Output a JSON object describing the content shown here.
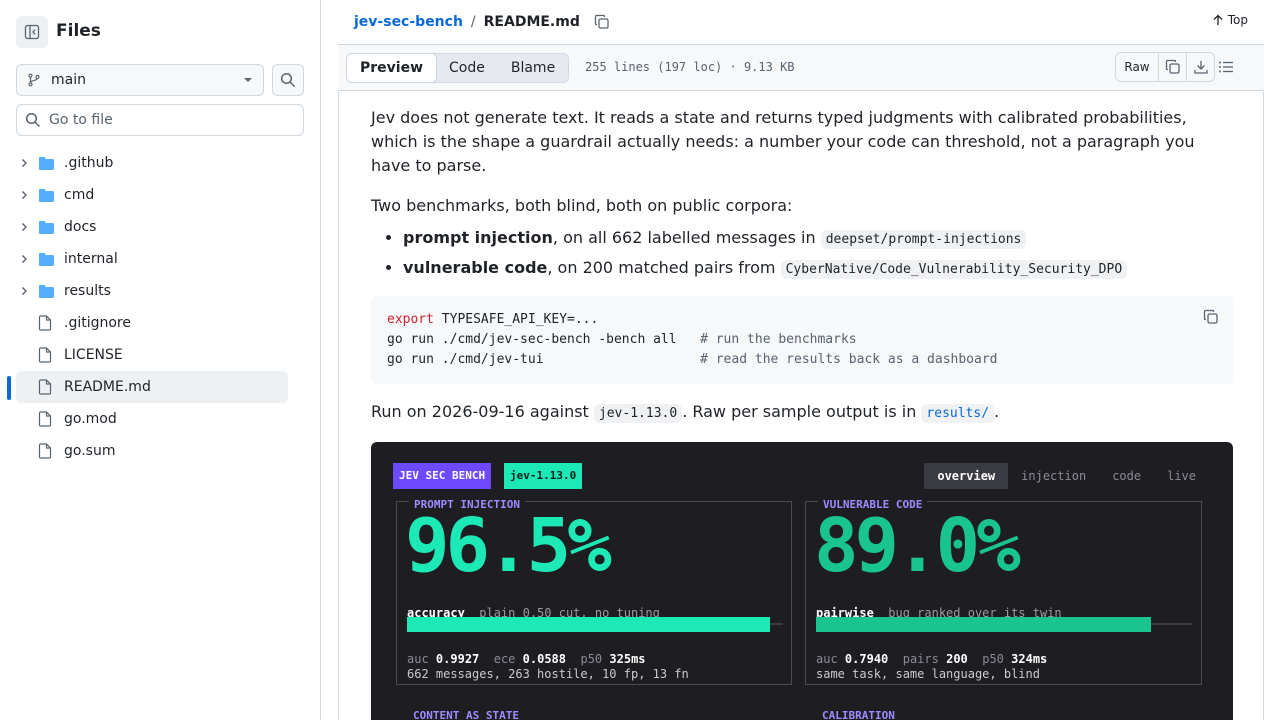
{
  "sidebar": {
    "title": "Files",
    "branch": "main",
    "goto_placeholder": "Go to file",
    "items": [
      {
        "name": ".github",
        "type": "folder"
      },
      {
        "name": "cmd",
        "type": "folder"
      },
      {
        "name": "docs",
        "type": "folder"
      },
      {
        "name": "internal",
        "type": "folder"
      },
      {
        "name": "results",
        "type": "folder"
      },
      {
        "name": ".gitignore",
        "type": "file"
      },
      {
        "name": "LICENSE",
        "type": "file"
      },
      {
        "name": "README.md",
        "type": "file",
        "active": true
      },
      {
        "name": "go.mod",
        "type": "file"
      },
      {
        "name": "go.sum",
        "type": "file"
      }
    ]
  },
  "header": {
    "repo": "jev-sec-bench",
    "separator": "/",
    "file": "README.md",
    "top_label": "Top"
  },
  "toolbar": {
    "tabs": [
      "Preview",
      "Code",
      "Blame"
    ],
    "selected_tab": "Preview",
    "file_info": "255 lines (197 loc) · 9.13 KB",
    "raw_label": "Raw"
  },
  "readme": {
    "para1": "Jev does not generate text. It reads a state and returns typed judgments with calibrated probabilities, which is the shape a guardrail actually needs: a number your code can threshold, not a paragraph you have to parse.",
    "para2": "Two benchmarks, both blind, both on public corpora:",
    "bullets": [
      {
        "bold": "prompt injection",
        "text": ", on all 662 labelled messages in ",
        "code": "deepset/prompt-injections"
      },
      {
        "bold": "vulnerable code",
        "text": ", on 200 matched pairs from ",
        "code": "CyberNative/Code_Vulnerability_Security_DPO"
      }
    ],
    "code_lines": {
      "l1_kw": "export",
      "l1_rest": " TYPESAFE_API_KEY=...",
      "l2_cmd": "go run ./cmd/jev-sec-bench -bench all   ",
      "l2_comment": "# run the benchmarks",
      "l3_cmd": "go run ./cmd/jev-tui                    ",
      "l3_comment": "# read the results back as a dashboard"
    },
    "run_line": {
      "t1": "Run on 2026-09-16 against ",
      "code": "jev-1.13.0",
      "t2": ". Raw per sample output is in ",
      "link": "results/",
      "t3": "."
    }
  },
  "dashboard": {
    "badge": "JEV SEC BENCH",
    "version": "jev-1.13.0",
    "tabs": [
      "overview",
      "injection",
      "code",
      "live"
    ],
    "active_tab": "overview",
    "panels": [
      {
        "title": "PROMPT INJECTION",
        "big": "96.5%",
        "big_color": "#1de9b6",
        "metric": "accuracy",
        "metric_note": "plain 0.50 cut, no tuning",
        "bar_fraction": 0.965,
        "bar_color": "#1de9b6",
        "k1": "auc",
        "v1": "0.9927",
        "k2": "ece",
        "v2": "0.0588",
        "k3": "p50",
        "v3": "325ms",
        "footer": "662 messages, 263 hostile, 10 fp, 13 fn"
      },
      {
        "title": "VULNERABLE CODE",
        "big": "89.0%",
        "big_color": "#19c48f",
        "metric": "pairwise",
        "metric_note": "bug ranked over its twin",
        "bar_fraction": 0.89,
        "bar_color": "#19c48f",
        "k1": "auc",
        "v1": "0.7940",
        "k2": "pairs",
        "v2": "200",
        "k3": "p50",
        "v3": "324ms",
        "footer": "same task, same language, blind"
      }
    ],
    "lower_titles": [
      "CONTENT AS STATE",
      "CALIBRATION"
    ]
  }
}
